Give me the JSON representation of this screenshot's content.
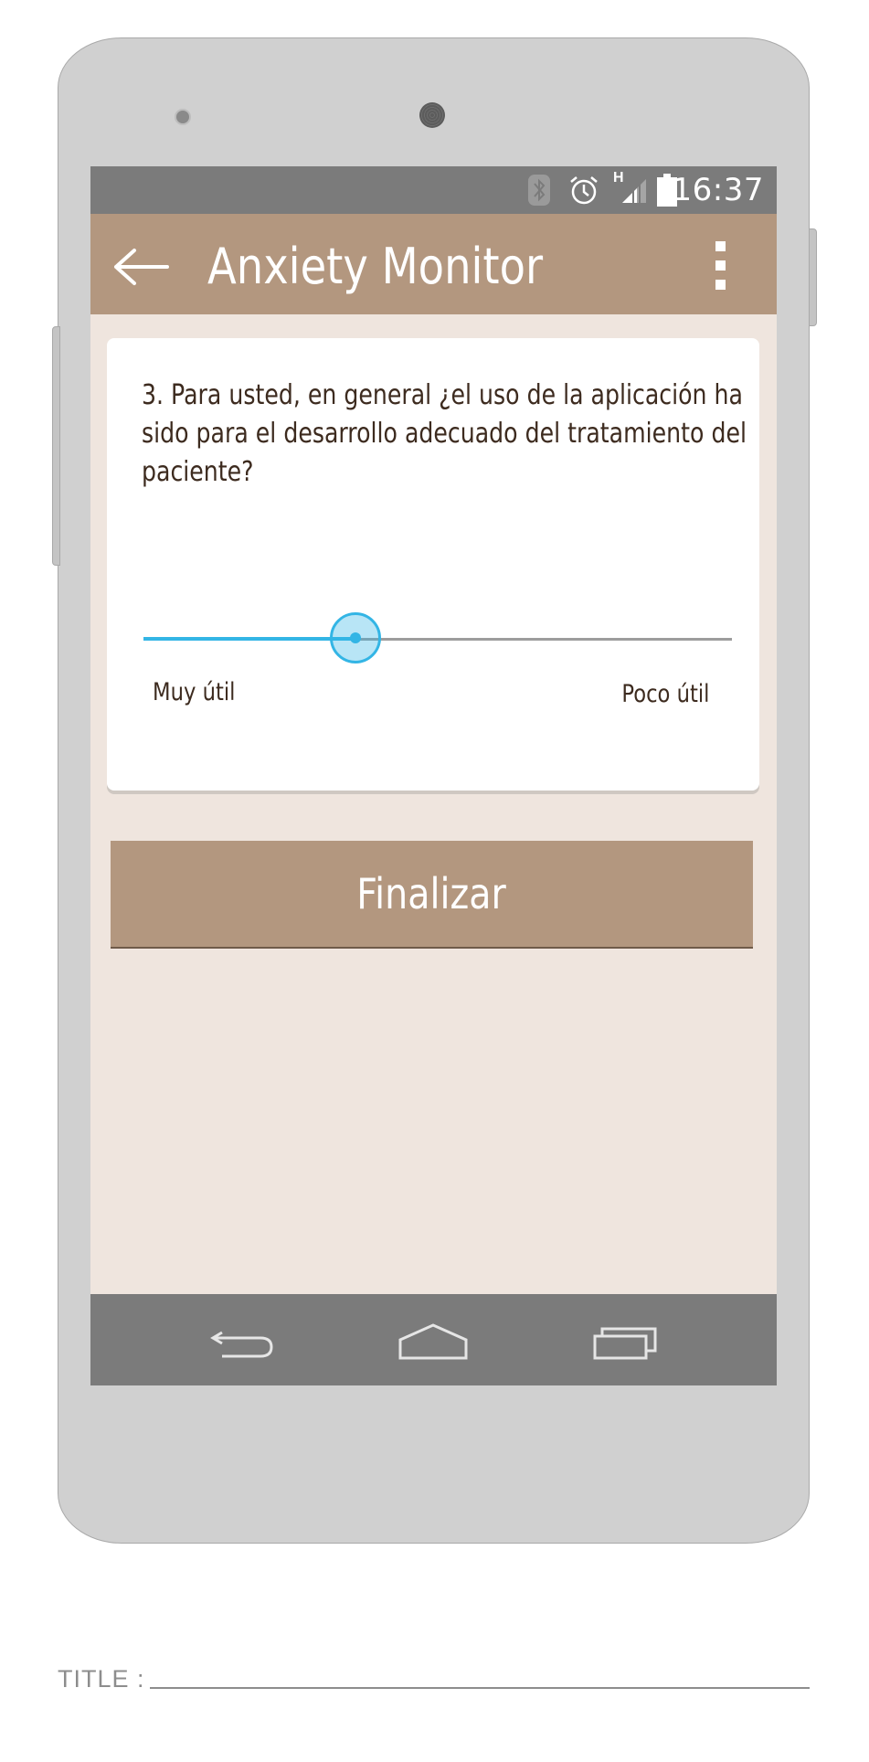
{
  "status_bar": {
    "time": "16:37",
    "network_label": "H",
    "icons": [
      "bluetooth-icon",
      "alarm-icon",
      "signal-icon",
      "battery-icon"
    ]
  },
  "app_bar": {
    "title": "Anxiety Monitor",
    "back_icon": "arrow-left-icon",
    "menu_icon": "overflow-menu-icon"
  },
  "question": {
    "text": "3. Para usted, en general ¿el uso de la aplicación ha sido para el desarrollo adecuado del tratamiento del paciente?",
    "slider": {
      "value_fraction": 0.36,
      "min_label": "Muy útil",
      "max_label": "Poco útil"
    }
  },
  "actions": {
    "finalize_label": "Finalizar"
  },
  "nav_bar": {
    "icons": [
      "nav-back-icon",
      "nav-home-icon",
      "nav-recents-icon"
    ]
  },
  "footer": {
    "title_label": "TITLE :"
  },
  "colors": {
    "app_bar": "#b3977f",
    "background": "#efe5de",
    "accent": "#33b5e5",
    "system_bars": "#7b7b7b",
    "text": "#3d2b1f"
  }
}
